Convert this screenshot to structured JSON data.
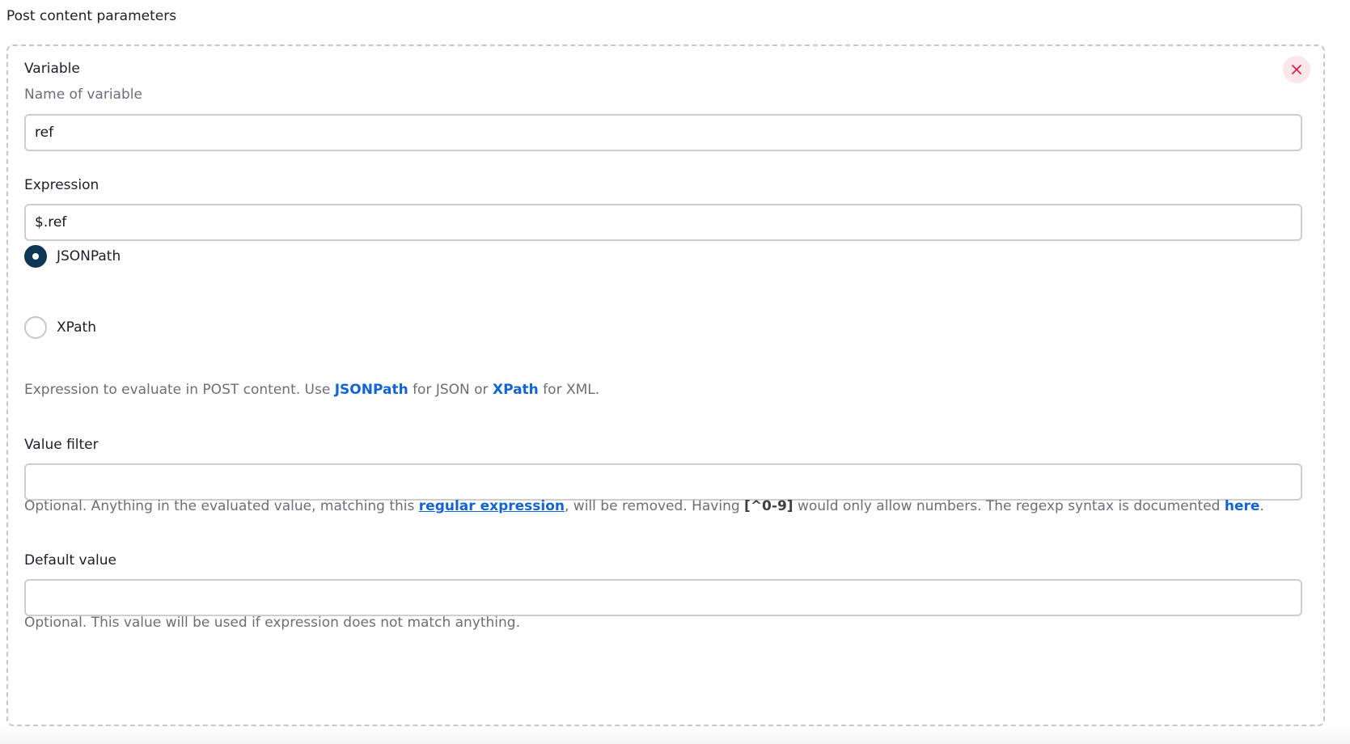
{
  "section": {
    "title": "Post content parameters"
  },
  "variable": {
    "label": "Variable",
    "description": "Name of variable",
    "value": "ref"
  },
  "expression": {
    "label": "Expression",
    "value": "$.ref",
    "options": [
      {
        "label": "JSONPath",
        "selected": true
      },
      {
        "label": "XPath",
        "selected": false
      }
    ],
    "help": {
      "prefix": "Expression to evaluate in POST content. Use ",
      "link1": "JSONPath",
      "middle": " for JSON or ",
      "link2": "XPath",
      "suffix": " for XML."
    }
  },
  "value_filter": {
    "label": "Value filter",
    "value": "",
    "help": {
      "prefix": "Optional. Anything in the evaluated value, matching this ",
      "link1": "regular expression",
      "middle1": ", will be removed. Having ",
      "code": "[^0-9]",
      "middle2": " would only allow numbers. The regexp syntax is documented ",
      "link2": "here",
      "suffix": "."
    }
  },
  "default_value": {
    "label": "Default value",
    "value": "",
    "help": "Optional. This value will be used if expression does not match anything."
  },
  "colors": {
    "accent": "#0d3554",
    "link": "#1264d3",
    "delete": "#d41d3f",
    "delete_bg": "#fbe6ea"
  },
  "icons": {
    "delete": "close-icon"
  }
}
